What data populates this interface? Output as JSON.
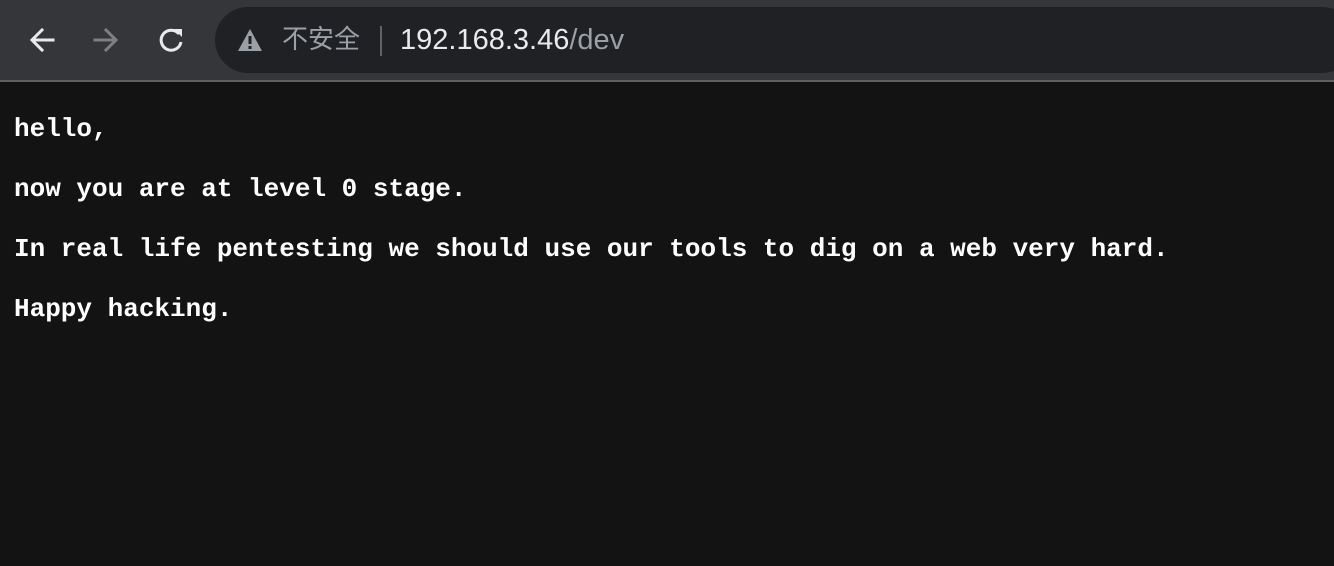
{
  "browser": {
    "back_icon": "arrow-left-icon",
    "forward_icon": "arrow-right-icon",
    "reload_icon": "reload-icon",
    "warning_icon": "warning-triangle-icon",
    "security_label": "不安全",
    "url_host": "192.168.3.46",
    "url_path": "/dev",
    "colors": {
      "toolbar": "#35363a",
      "omnibox": "#202124",
      "page_background": "#131313"
    }
  },
  "page": {
    "lines": [
      "hello,",
      "now you are at level 0 stage.",
      "In real life pentesting we should use our tools to dig on a web very hard.",
      "Happy hacking."
    ]
  }
}
